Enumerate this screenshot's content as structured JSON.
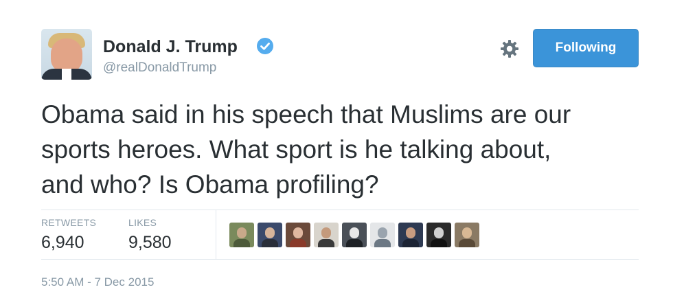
{
  "user": {
    "name": "Donald J. Trump",
    "handle": "@realDonaldTrump",
    "verified": true
  },
  "follow_button": {
    "label": "Following"
  },
  "settings": {
    "icon": "gear-icon"
  },
  "tweet": {
    "lines": [
      "Obama said in his speech that Muslims are our",
      "sports heroes. What sport is he talking about,",
      "and who? Is Obama profiling?"
    ]
  },
  "stats": {
    "retweets_label": "RETWEETS",
    "retweets_value": "6,940",
    "likes_label": "LIKES",
    "likes_value": "9,580"
  },
  "likers": [
    {
      "bg": "#7a8a5c",
      "face": "#c9a98a",
      "shirt": "#4d5a3a"
    },
    {
      "bg": "#3b4a6b",
      "face": "#d6b49a",
      "shirt": "#2a2f3a"
    },
    {
      "bg": "#6b4a3a",
      "face": "#e0b8a0",
      "shirt": "#8a3a2a"
    },
    {
      "bg": "#d8d4cc",
      "face": "#c49a7c",
      "shirt": "#3a3a3a"
    },
    {
      "bg": "#4a5058",
      "face": "#e8e8e8",
      "shirt": "#1e2226"
    },
    {
      "bg": "#e4e6e8",
      "face": "#9aa4ae",
      "shirt": "#6c7884"
    },
    {
      "bg": "#2e3a52",
      "face": "#c89c80",
      "shirt": "#1c2434"
    },
    {
      "bg": "#2a2a2a",
      "face": "#d0d0d0",
      "shirt": "#111111"
    },
    {
      "bg": "#8a7a64",
      "face": "#d8b894",
      "shirt": "#5a4a38"
    }
  ],
  "timestamp": "5:50 AM - 7 Dec 2015",
  "colors": {
    "accent": "#3b94d9",
    "verified": "#55acee",
    "muted_text": "#8899a6",
    "text": "#292f33",
    "divider": "#e1e8ed"
  }
}
